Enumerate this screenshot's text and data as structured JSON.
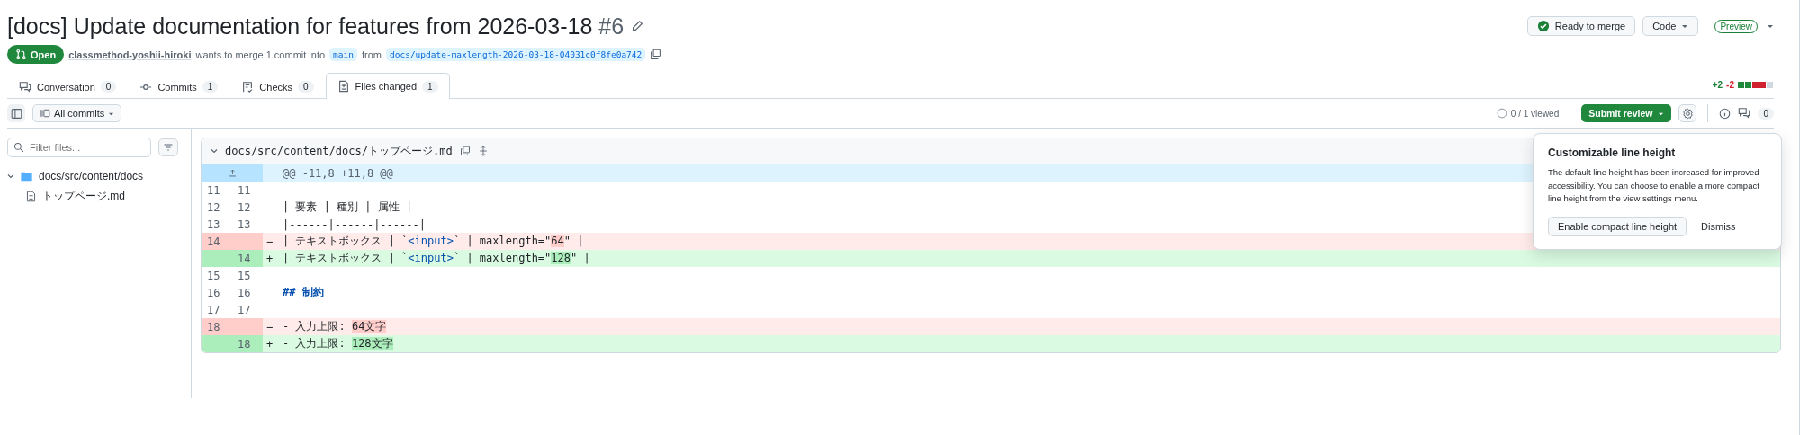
{
  "pr": {
    "title": "[docs] Update documentation for features from 2026-03-18",
    "number": "#6",
    "state": "Open",
    "author": "classmethod-yoshii-hiroki",
    "merge_text": "wants to merge 1 commit into",
    "base": "main",
    "from_text": "from",
    "head": "docs/update-maxlength-2026-03-18-04031c0f8fe0a742"
  },
  "header_actions": {
    "merge_status": "Ready to merge",
    "code_button": "Code",
    "preview_label": "Preview"
  },
  "tabs": [
    {
      "label": "Conversation",
      "count": "0",
      "selected": false
    },
    {
      "label": "Commits",
      "count": "1",
      "selected": false
    },
    {
      "label": "Checks",
      "count": "0",
      "selected": false
    },
    {
      "label": "Files changed",
      "count": "1",
      "selected": true
    }
  ],
  "diffstat": {
    "additions": "+2",
    "deletions": "-2"
  },
  "toolbar": {
    "commits_filter": "All commits",
    "viewed": "0 / 1 viewed",
    "submit": "Submit review",
    "comments_count": "0"
  },
  "sidebar": {
    "filter_placeholder": "Filter files...",
    "tree": [
      {
        "name": "docs/src/content/docs",
        "kind": "folder",
        "expanded": true,
        "children": [
          {
            "name": "トップページ.md",
            "kind": "file"
          }
        ]
      }
    ]
  },
  "file": {
    "path": "docs/src/content/docs/トップページ.md",
    "expanded": true,
    "rows": [
      {
        "kind": "hunk",
        "segments": [
          {
            "text": "@@ -11,8 +11,8 @@",
            "kind": "plain"
          }
        ]
      },
      {
        "kind": "context",
        "old": "11",
        "new": "11",
        "segments": []
      },
      {
        "kind": "context",
        "old": "12",
        "new": "12",
        "segments": [
          {
            "text": "| 要素 | 種別 | 属性 |",
            "kind": "plain"
          }
        ]
      },
      {
        "kind": "context",
        "old": "13",
        "new": "13",
        "segments": [
          {
            "text": "|------|------|------|",
            "kind": "plain"
          }
        ]
      },
      {
        "kind": "deletion",
        "old": "14",
        "sign": "−",
        "segments": [
          {
            "text": "| テキストボックス | `",
            "kind": "plain"
          },
          {
            "text": "<input>",
            "kind": "tag"
          },
          {
            "text": "` | maxlength=\"",
            "kind": "plain"
          },
          {
            "text": "64",
            "kind": "highlight"
          },
          {
            "text": "\" |",
            "kind": "plain"
          }
        ]
      },
      {
        "kind": "addition",
        "new": "14",
        "sign": "+",
        "segments": [
          {
            "text": "| テキストボックス | `",
            "kind": "plain"
          },
          {
            "text": "<input>",
            "kind": "tag"
          },
          {
            "text": "` | maxlength=\"",
            "kind": "plain"
          },
          {
            "text": "128",
            "kind": "highlight"
          },
          {
            "text": "\" |",
            "kind": "plain"
          }
        ]
      },
      {
        "kind": "context",
        "old": "15",
        "new": "15",
        "segments": []
      },
      {
        "kind": "context",
        "old": "16",
        "new": "16",
        "segments": [
          {
            "text": "## 制約",
            "kind": "heading"
          }
        ]
      },
      {
        "kind": "context",
        "old": "17",
        "new": "17",
        "segments": []
      },
      {
        "kind": "deletion",
        "old": "18",
        "sign": "−",
        "segments": [
          {
            "text": "- 入力上限: ",
            "kind": "plain"
          },
          {
            "text": "64文字",
            "kind": "highlight"
          }
        ]
      },
      {
        "kind": "addition",
        "new": "18",
        "sign": "+",
        "segments": [
          {
            "text": "- 入力上限: ",
            "kind": "plain"
          },
          {
            "text": "128文字",
            "kind": "highlight"
          }
        ]
      }
    ]
  },
  "popover": {
    "title": "Customizable line height",
    "body": "The default line height has been increased for improved accessibility. You can choose to enable a more compact line height from the view settings menu.",
    "primary": "Enable compact line height",
    "secondary": "Dismiss"
  }
}
